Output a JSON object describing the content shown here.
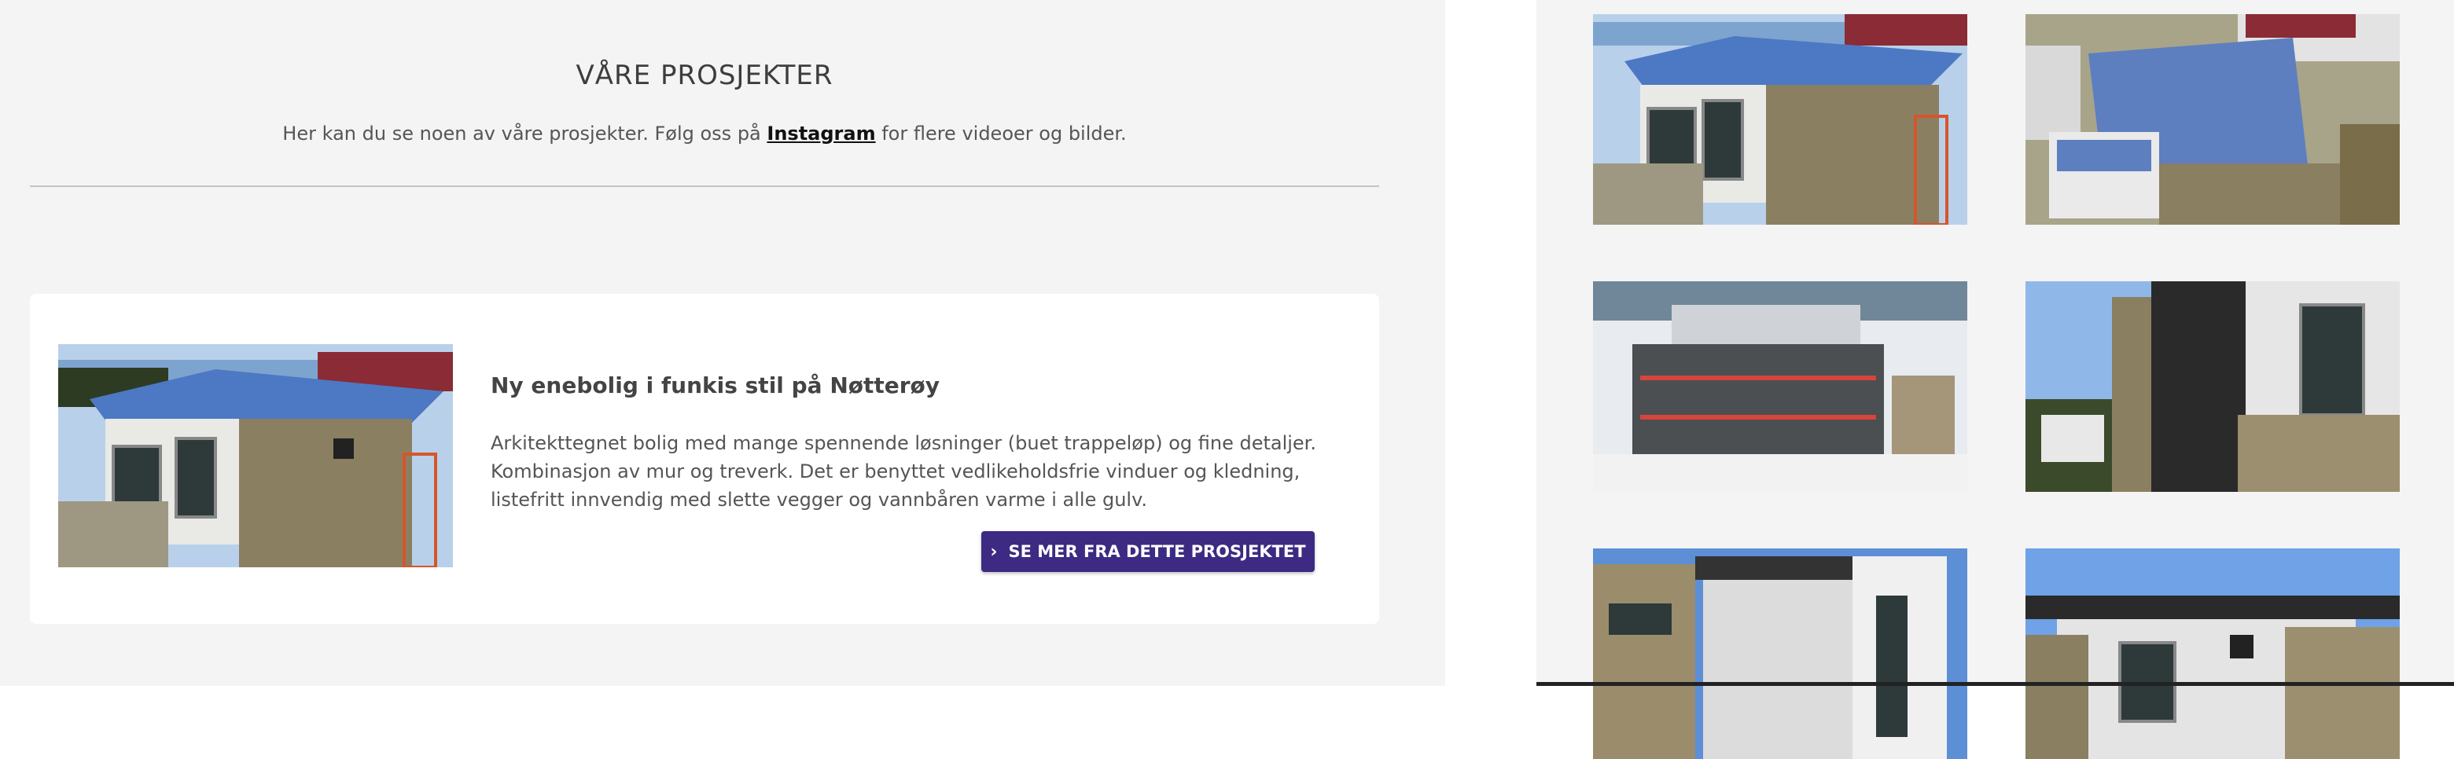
{
  "header": {
    "title": "VÅRE PROSJEKTER",
    "subtitle_before": "Her kan du se noen av våre prosjekter. Følg oss på ",
    "instagram_link": "Instagram",
    "subtitle_after": " for flere videoer og bilder."
  },
  "project": {
    "title": "Ny enebolig i funkis stil på Nøtterøy",
    "description": "Arkitekttegnet bolig med mange spennende løsninger (buet trappeløp) og fine detaljer. Kombinasjon av mur og treverk. Det er benyttet vedlikeholdsfrie vinduer og kledning, listefritt innvendig med slette vegger og vannbåren varme i alle gulv.",
    "button_label": "SE MER FRA DETTE PROSJEKTET",
    "button_icon": "chevron-right-icon"
  },
  "gallery": {
    "count": 6
  },
  "colors": {
    "background": "#f4f4f4",
    "card": "#ffffff",
    "button": "#3d2a82",
    "roof": "#4c78c4",
    "sky": "#8fb8e8"
  }
}
